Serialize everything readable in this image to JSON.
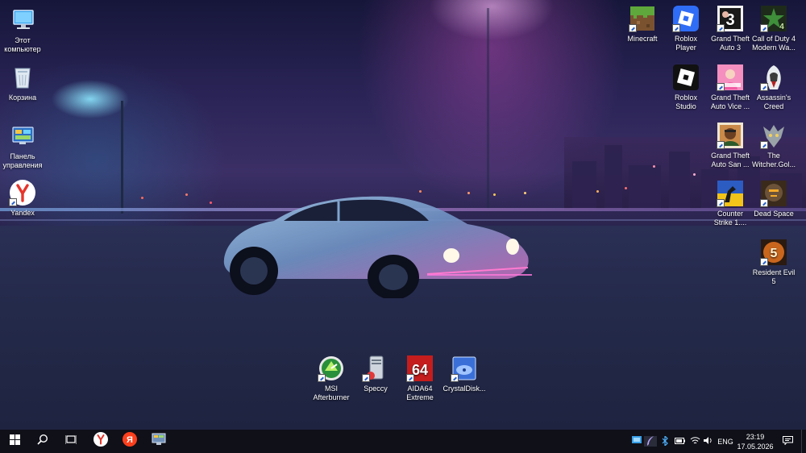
{
  "desktop": {
    "left_icons": [
      {
        "label": "Этот компьютер",
        "icon": "this-pc-icon"
      },
      {
        "label": "Корзина",
        "icon": "recycle-bin-icon"
      },
      {
        "label": "Панель управления",
        "icon": "control-panel-icon"
      },
      {
        "label": "Yandex",
        "icon": "yandex-browser-icon"
      }
    ],
    "right_icons": [
      {
        "label": "Minecraft",
        "icon": "minecraft-icon"
      },
      {
        "label": "Roblox Player",
        "icon": "roblox-player-icon"
      },
      {
        "label": "Grand Theft Auto 3",
        "icon": "gta3-icon"
      },
      {
        "label": "Call of Duty 4 Modern Wa...",
        "icon": "cod4-icon"
      },
      {
        "label": "Roblox Studio",
        "icon": "roblox-studio-icon"
      },
      {
        "label": "Grand Theft Auto Vice ...",
        "icon": "gta-vice-city-icon"
      },
      {
        "label": "Assassin's Creed",
        "icon": "assassins-creed-icon"
      },
      {
        "label": "Grand Theft Auto San ...",
        "icon": "gta-san-andreas-icon"
      },
      {
        "label": "The Witcher.Gol...",
        "icon": "witcher-icon"
      },
      {
        "label": "Counter Strike 1....",
        "icon": "counter-strike-icon"
      },
      {
        "label": "Dead Space",
        "icon": "dead-space-icon"
      },
      {
        "label": "Resident Evil 5",
        "icon": "resident-evil-5-icon"
      }
    ],
    "bottom_icons": [
      {
        "label": "MSI Afterburner",
        "icon": "msi-afterburner-icon"
      },
      {
        "label": "Speccy",
        "icon": "speccy-icon"
      },
      {
        "label": "AIDA64 Extreme",
        "icon": "aida64-icon",
        "badge": "64"
      },
      {
        "label": "CrystalDisk...",
        "icon": "crystaldisk-icon"
      }
    ]
  },
  "taskbar": {
    "start_icon": "windows-start-icon",
    "search_icon": "search-icon",
    "task_view_icon": "task-view-icon",
    "pinned": [
      {
        "name": "yandex-browser",
        "glyph": "Y",
        "color": "#e6352b"
      },
      {
        "name": "yandex",
        "glyph": "Я",
        "color": "#fc3f1d"
      },
      {
        "name": "control-panel",
        "glyph": "",
        "color": "#6f8fb8"
      }
    ],
    "tray": {
      "language": "ENG",
      "time": "23:19",
      "date": "17.05.2026"
    }
  },
  "colors": {
    "taskbar_bg": "#0f1018",
    "accent_pink": "#ff4fb8",
    "accent_cyan": "#5fd6ff"
  }
}
